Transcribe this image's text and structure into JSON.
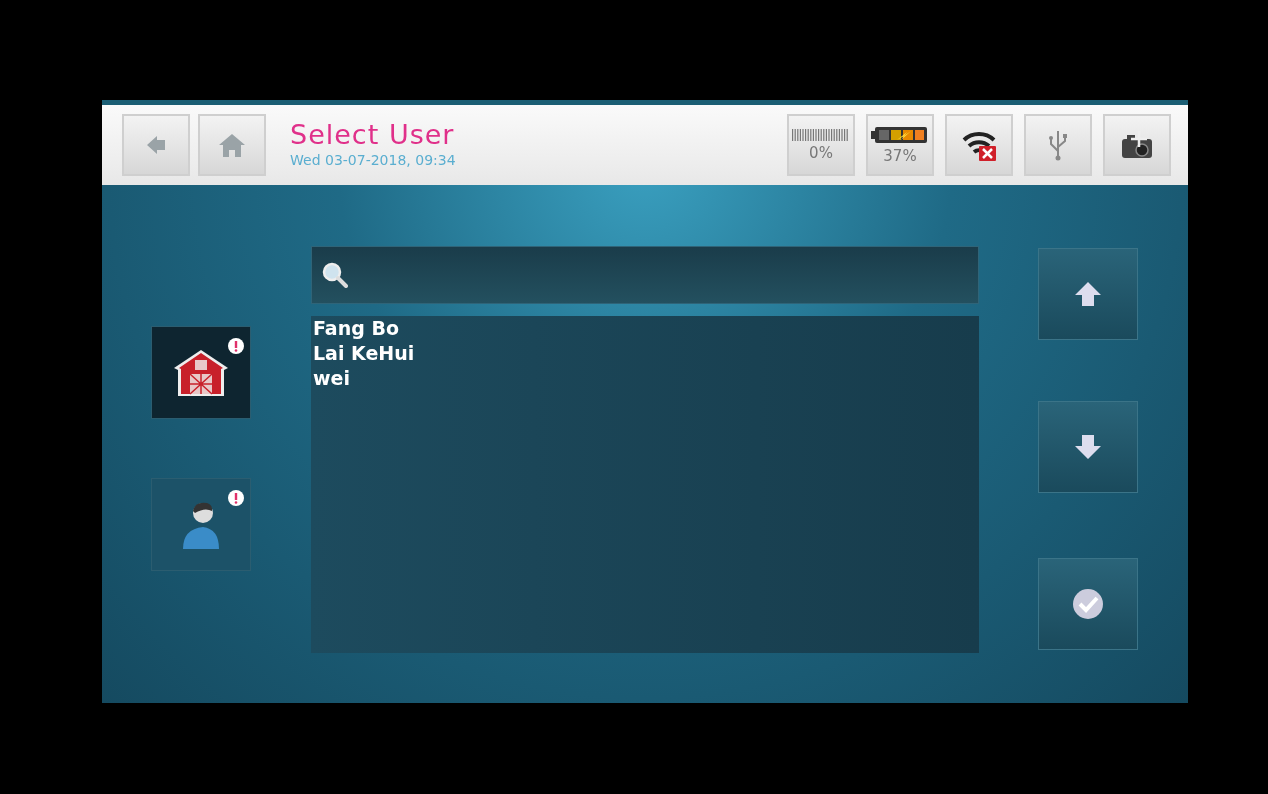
{
  "header": {
    "title": "Select User",
    "datetime": "Wed 03-07-2018, 09:34",
    "status": [
      {
        "kind": "storage",
        "reading": "0%"
      },
      {
        "kind": "battery",
        "reading": "37%"
      },
      {
        "kind": "wifi"
      },
      {
        "kind": "usb"
      },
      {
        "kind": "camera"
      }
    ]
  },
  "modes": [
    {
      "kind": "farm",
      "selected": true,
      "alert": true
    },
    {
      "kind": "user",
      "selected": false,
      "alert": true
    }
  ],
  "users": [
    "Fang Bo",
    "Lai KeHui",
    "wei"
  ],
  "side_buttons": [
    {
      "kind": "up"
    },
    {
      "kind": "down"
    },
    {
      "kind": "confirm"
    }
  ]
}
